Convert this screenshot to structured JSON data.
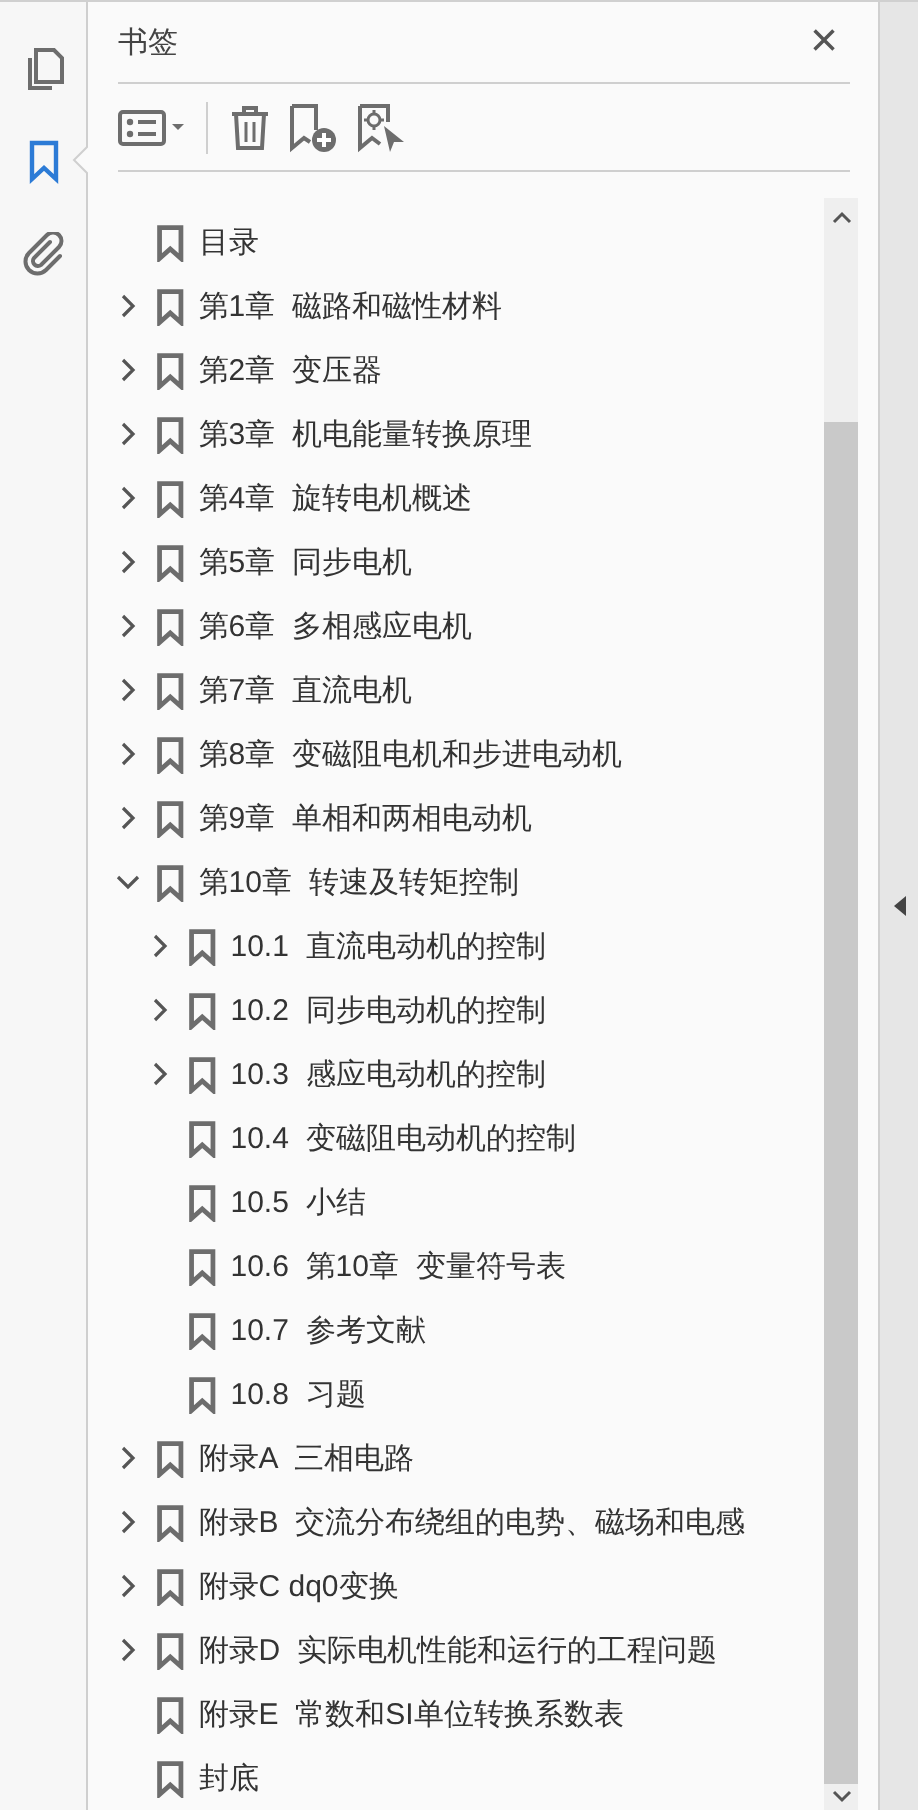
{
  "tool_rail": [
    {
      "kind": "pages",
      "selected": false
    },
    {
      "kind": "bookmarks",
      "selected": true
    },
    {
      "kind": "attachments",
      "selected": false
    }
  ],
  "panel": {
    "title": "书签",
    "close": "×"
  },
  "bookmarks": [
    {
      "title": "目录"
    },
    {
      "title": "第1章  磁路和磁性材料",
      "expanded": false
    },
    {
      "title": "第2章  变压器",
      "expanded": false
    },
    {
      "title": "第3章  机电能量转换原理",
      "expanded": false
    },
    {
      "title": "第4章  旋转电机概述",
      "expanded": false
    },
    {
      "title": "第5章  同步电机",
      "expanded": false
    },
    {
      "title": "第6章  多相感应电机",
      "expanded": false
    },
    {
      "title": "第7章  直流电机",
      "expanded": false
    },
    {
      "title": "第8章  变磁阻电机和步进电动机",
      "expanded": false
    },
    {
      "title": "第9章  单相和两相电动机",
      "expanded": false
    },
    {
      "title": "第10章  转速及转矩控制",
      "expanded": true,
      "children": [
        {
          "title": "10.1  直流电动机的控制",
          "expanded": false
        },
        {
          "title": "10.2  同步电动机的控制",
          "expanded": false
        },
        {
          "title": "10.3  感应电动机的控制",
          "expanded": false
        },
        {
          "title": "10.4  变磁阻电动机的控制"
        },
        {
          "title": "10.5  小结"
        },
        {
          "title": "10.6  第10章  变量符号表"
        },
        {
          "title": "10.7  参考文献"
        },
        {
          "title": "10.8  习题"
        }
      ]
    },
    {
      "title": "附录A  三相电路",
      "expanded": false
    },
    {
      "title": "附录B  交流分布绕组的电势、磁场和电感",
      "expanded": false
    },
    {
      "title": "附录C dq0变换",
      "expanded": false
    },
    {
      "title": "附录D  实际电机性能和运行的工程问题",
      "expanded": false
    },
    {
      "title": "附录E  常数和SI单位转换系数表"
    },
    {
      "title": "封底"
    }
  ]
}
